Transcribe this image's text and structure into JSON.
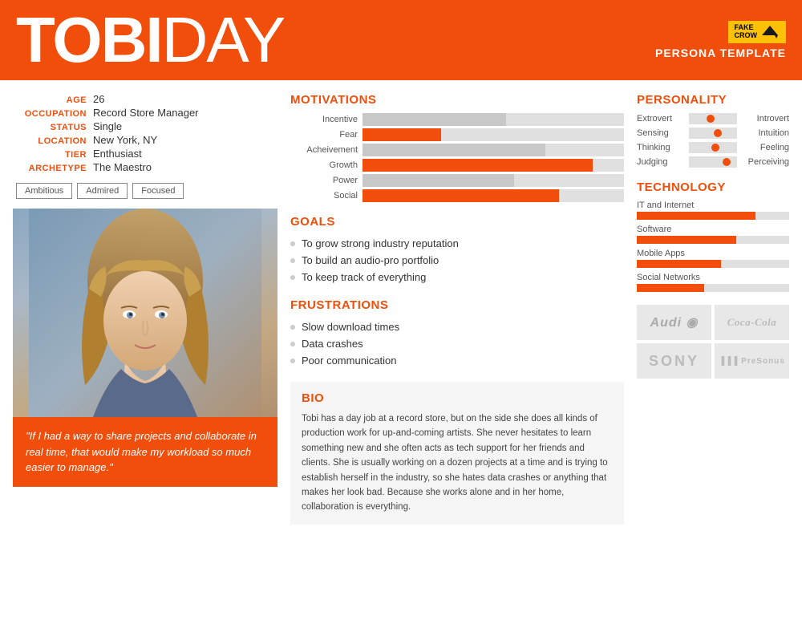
{
  "header": {
    "first_name": "TOBI",
    "last_name": "DAY",
    "badge_line1": "FAKE",
    "badge_line2": "CROW",
    "persona_label": "PERSONA TEMPLATE"
  },
  "profile": {
    "age_label": "AGE",
    "age_value": "26",
    "occupation_label": "OCCUPATION",
    "occupation_value": "Record Store Manager",
    "status_label": "STATUS",
    "status_value": "Single",
    "location_label": "LOCATION",
    "location_value": "New York, NY",
    "tier_label": "TIER",
    "tier_value": "Enthusiast",
    "archetype_label": "ARCHETYPE",
    "archetype_value": "The Maestro"
  },
  "tags": [
    "Ambitious",
    "Admired",
    "Focused"
  ],
  "quote": "\"If I had a way to share projects and collaborate in real time, that would make my workload so much easier to manage.\"",
  "motivations": {
    "title": "MOTIVATIONS",
    "bars": [
      {
        "label": "Incentive",
        "pct": 55,
        "style": "odd"
      },
      {
        "label": "Fear",
        "pct": 30,
        "style": "even"
      },
      {
        "label": "Acheivement",
        "pct": 70,
        "style": "odd"
      },
      {
        "label": "Growth",
        "pct": 88,
        "style": "even"
      },
      {
        "label": "Power",
        "pct": 58,
        "style": "odd"
      },
      {
        "label": "Social",
        "pct": 75,
        "style": "even"
      }
    ]
  },
  "goals": {
    "title": "GOALS",
    "items": [
      "To grow strong industry reputation",
      "To build an audio-pro portfolio",
      "To keep track of everything"
    ]
  },
  "frustrations": {
    "title": "FRUSTRATIONS",
    "items": [
      "Slow download times",
      "Data crashes",
      "Poor communication"
    ]
  },
  "bio": {
    "title": "BIO",
    "text": "Tobi has a day job at a record store, but on the side she does all kinds of production work for up-and-coming artists.  She never hesitates to learn something new and she often acts as tech support for her friends and clients. She is usually working on a dozen projects at a time and is trying to establish herself in the industry, so she hates data crashes or anything that makes her look bad. Because she works alone and in her home, collaboration is everything."
  },
  "personality": {
    "title": "PERSONALITY",
    "sliders": [
      {
        "left": "Extrovert",
        "right": "Introvert",
        "dot_pct": 45
      },
      {
        "left": "Sensing",
        "right": "Intuition",
        "dot_pct": 60
      },
      {
        "left": "Thinking",
        "right": "Feeling",
        "dot_pct": 55
      },
      {
        "left": "Judging",
        "right": "Perceiving",
        "dot_pct": 78
      }
    ]
  },
  "technology": {
    "title": "TECHNOLOGY",
    "bars": [
      {
        "label": "IT and Internet",
        "pct": 78
      },
      {
        "label": "Software",
        "pct": 65
      },
      {
        "label": "Mobile Apps",
        "pct": 55
      },
      {
        "label": "Social Networks",
        "pct": 44
      }
    ]
  },
  "brands": [
    {
      "name": "Audi",
      "style": "audi"
    },
    {
      "name": "Coca-Cola",
      "style": "coca"
    },
    {
      "name": "SONY",
      "style": "sony"
    },
    {
      "name": "PreSonus",
      "style": "presonus"
    }
  ]
}
